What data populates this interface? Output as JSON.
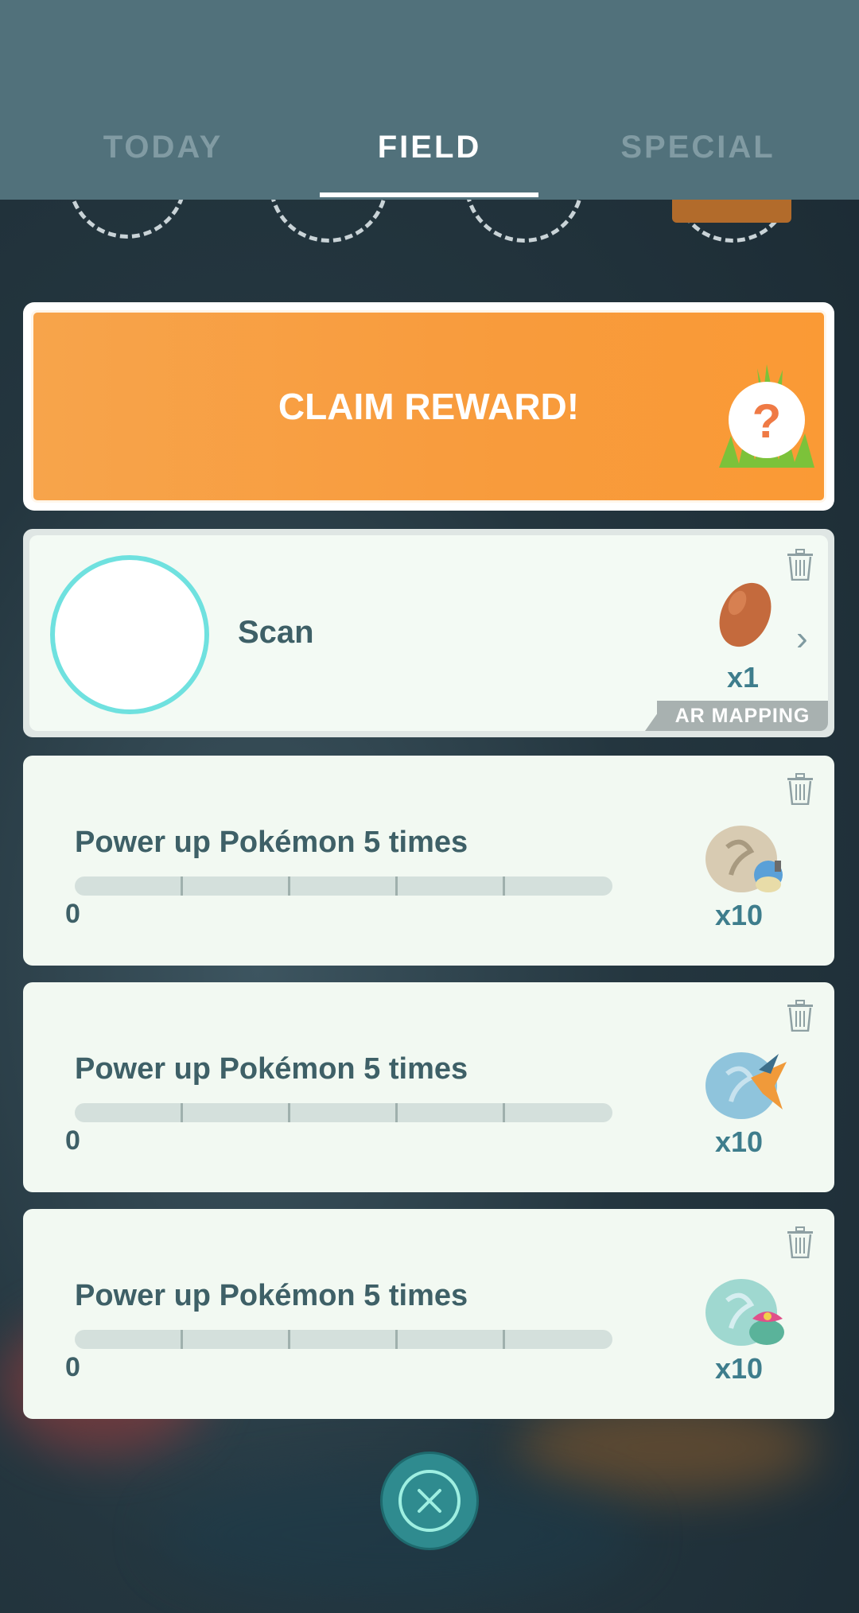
{
  "tabs": [
    {
      "label": "TODAY",
      "active": false
    },
    {
      "label": "FIELD",
      "active": true
    },
    {
      "label": "SPECIAL",
      "active": false
    }
  ],
  "claim": {
    "label": "CLAIM REWARD!",
    "mystery_symbol": "?"
  },
  "scan_task": {
    "label": "Scan",
    "reward_icon": "pinap-berry-icon",
    "reward_count": "x1",
    "badge": "AR MAPPING",
    "chevron": "›"
  },
  "tasks": [
    {
      "title": "Power up Pokémon 5 times",
      "progress_value": "0",
      "progress_fraction": 0,
      "reward_icon": "blastoise-mega-energy-icon",
      "reward_count": "x10"
    },
    {
      "title": "Power up Pokémon 5 times",
      "progress_value": "0",
      "progress_fraction": 0,
      "reward_icon": "charizard-mega-energy-icon",
      "reward_count": "x10"
    },
    {
      "title": "Power up Pokémon 5 times",
      "progress_value": "0",
      "progress_fraction": 0,
      "reward_icon": "venusaur-mega-energy-icon",
      "reward_count": "x10"
    }
  ],
  "colors": {
    "header_bg": "#51717b",
    "claim_orange": "#f89b3c",
    "card_bg": "#f2f9f2",
    "text_dark": "#3e6067",
    "accent_teal": "#2f8b8f"
  }
}
